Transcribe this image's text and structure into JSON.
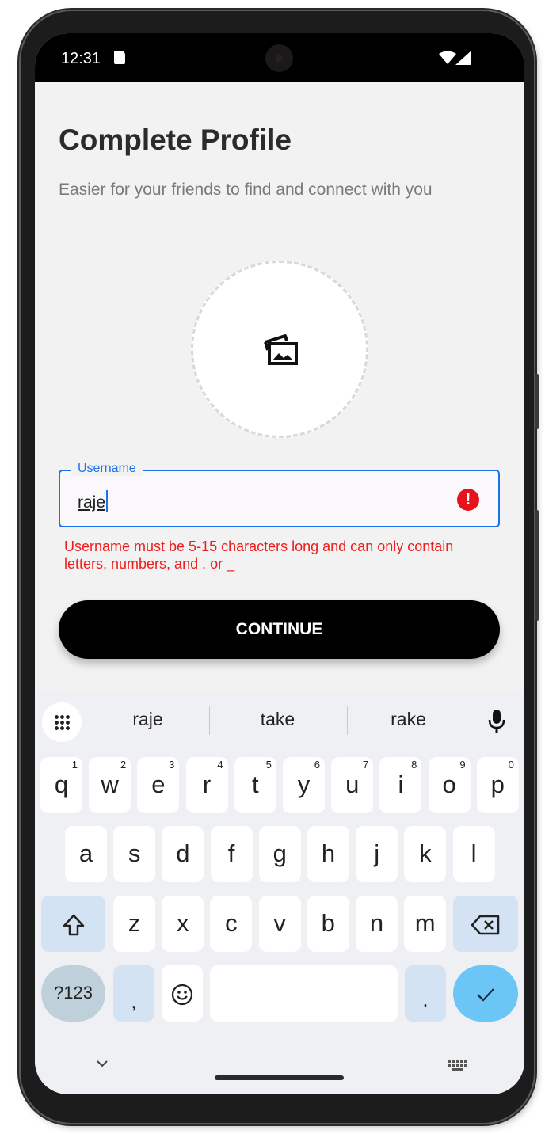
{
  "status_bar": {
    "time": "12:31"
  },
  "header": {
    "title": "Complete Profile",
    "subtitle": "Easier for your friends to find and connect with you"
  },
  "username": {
    "label": "Username",
    "value": "raje",
    "error": "Username must be 5-15 characters long and can only contain letters, numbers, and . or _"
  },
  "actions": {
    "continue_label": "CONTINUE"
  },
  "keyboard": {
    "suggestions": [
      "raje",
      "take",
      "rake"
    ],
    "row1": [
      {
        "k": "q",
        "h": "1"
      },
      {
        "k": "w",
        "h": "2"
      },
      {
        "k": "e",
        "h": "3"
      },
      {
        "k": "r",
        "h": "4"
      },
      {
        "k": "t",
        "h": "5"
      },
      {
        "k": "y",
        "h": "6"
      },
      {
        "k": "u",
        "h": "7"
      },
      {
        "k": "i",
        "h": "8"
      },
      {
        "k": "o",
        "h": "9"
      },
      {
        "k": "p",
        "h": "0"
      }
    ],
    "row2": [
      "a",
      "s",
      "d",
      "f",
      "g",
      "h",
      "j",
      "k",
      "l"
    ],
    "row3": [
      "z",
      "x",
      "c",
      "v",
      "b",
      "n",
      "m"
    ],
    "symbols_label": "?123",
    "comma_label": ",",
    "period_label": "."
  },
  "colors": {
    "accent": "#1a73e8",
    "error": "#ee1c1c",
    "button": "#000000",
    "enter_key": "#6cc6f5"
  }
}
